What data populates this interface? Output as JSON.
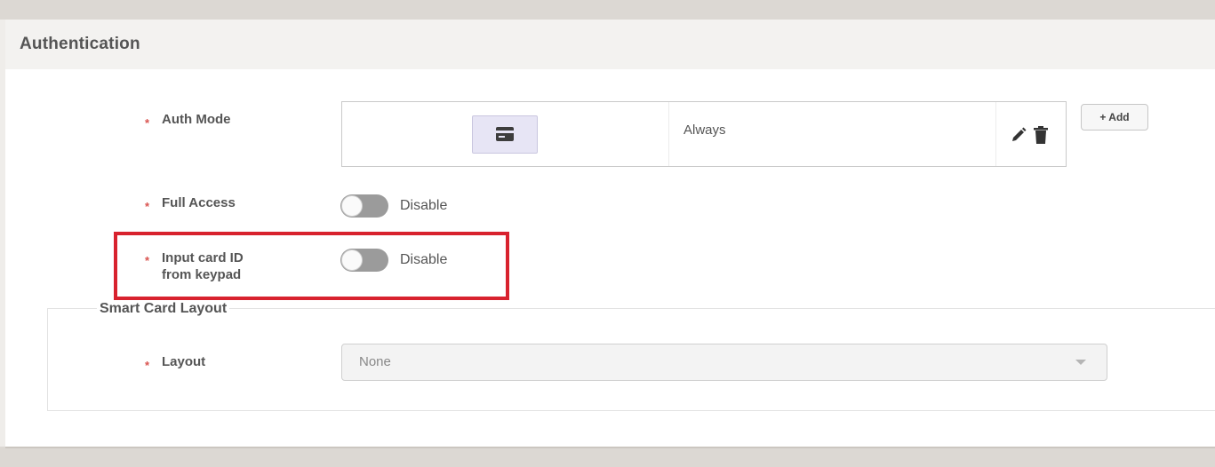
{
  "section": {
    "title": "Authentication"
  },
  "required_marker": "*",
  "auth_mode": {
    "label": "Auth Mode",
    "rows": [
      {
        "credential_icon": "card-icon",
        "schedule": "Always"
      }
    ],
    "add_label": "+ Add"
  },
  "full_access": {
    "label": "Full Access",
    "state": "Disable"
  },
  "input_card_id": {
    "label_line1": "Input card ID",
    "label_line2": "from keypad",
    "state": "Disable"
  },
  "smart_card_layout": {
    "legend": "Smart Card Layout",
    "layout_label": "Layout",
    "layout_value": "None"
  },
  "colors": {
    "required": "#d9534f",
    "highlight": "#d8222e",
    "toggle_off": "#9b9b9b"
  }
}
